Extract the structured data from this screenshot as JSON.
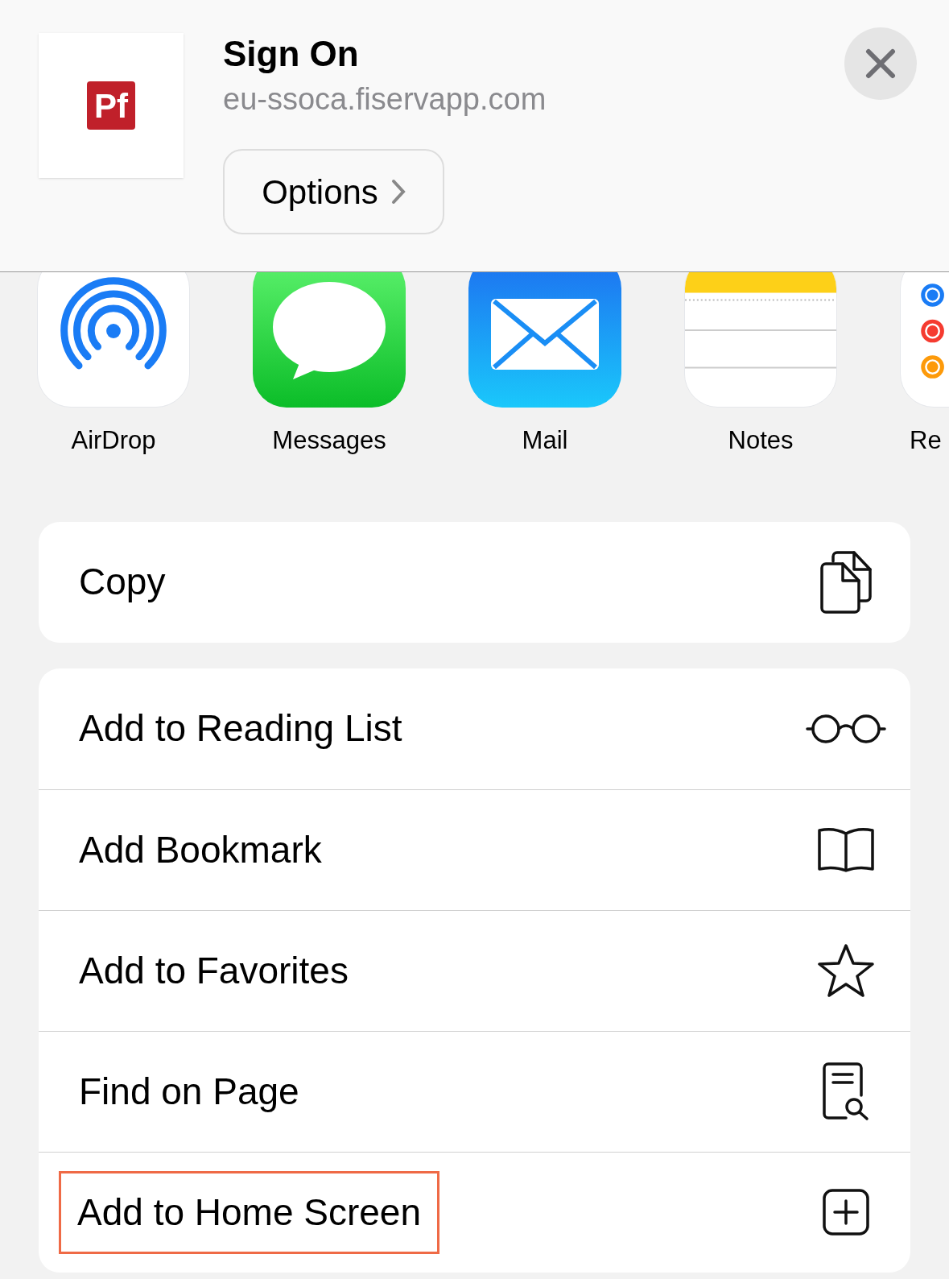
{
  "header": {
    "logo_text": "Pf",
    "title": "Sign On",
    "subtitle": "eu-ssoca.fiservapp.com",
    "options_button": "Options"
  },
  "apps": [
    {
      "kind": "airdrop",
      "label": "AirDrop"
    },
    {
      "kind": "messages",
      "label": "Messages"
    },
    {
      "kind": "mail",
      "label": "Mail"
    },
    {
      "kind": "notes",
      "label": "Notes"
    },
    {
      "kind": "reminders",
      "label": "Re"
    }
  ],
  "copy_action": {
    "label": "Copy",
    "kind": "copy"
  },
  "actions": [
    {
      "label": "Add to Reading List",
      "kind": "glasses",
      "highlighted": false
    },
    {
      "label": "Add Bookmark",
      "kind": "book",
      "highlighted": false
    },
    {
      "label": "Add to Favorites",
      "kind": "star",
      "highlighted": false
    },
    {
      "label": "Find on Page",
      "kind": "find",
      "highlighted": false
    },
    {
      "label": "Add to Home Screen",
      "kind": "add",
      "highlighted": true
    }
  ]
}
